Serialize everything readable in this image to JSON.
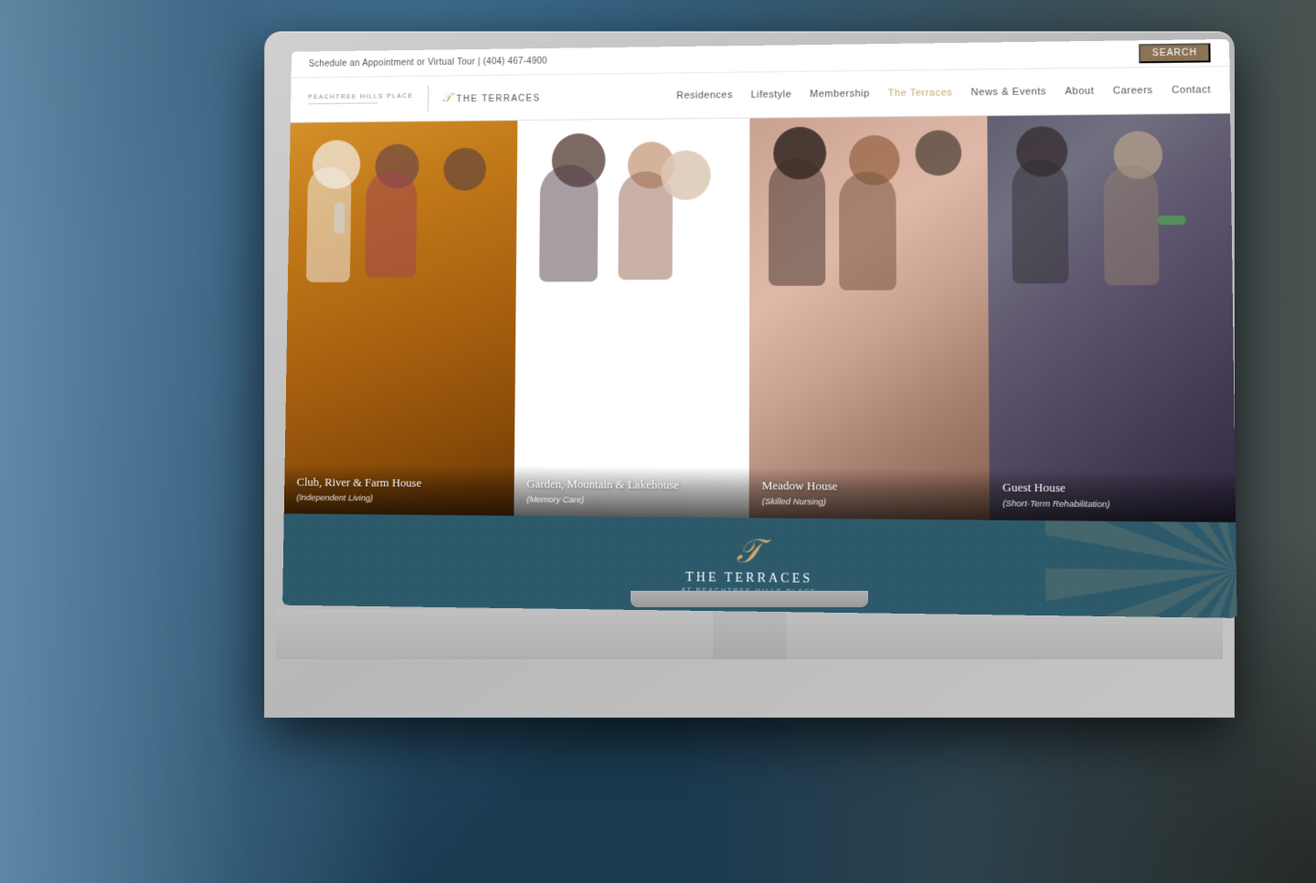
{
  "page": {
    "title": "The Terraces at Peachtree Hills Place"
  },
  "background": {
    "color": "#3d6b8a"
  },
  "topbar": {
    "contact_text": "Schedule an Appointment or Virtual Tour | (404) 467-4900",
    "search_label": "SEARCH"
  },
  "logo": {
    "peachtree_line1": "PEACHTREE HILLS PLACE",
    "terraces_name": "THE TERRACES"
  },
  "nav": {
    "links": [
      {
        "label": "Residences",
        "active": false
      },
      {
        "label": "Lifestyle",
        "active": false
      },
      {
        "label": "Membership",
        "active": false
      },
      {
        "label": "The Terraces",
        "active": true
      },
      {
        "label": "News & Events",
        "active": false
      },
      {
        "label": "About",
        "active": false
      },
      {
        "label": "Careers",
        "active": false
      },
      {
        "label": "Contact",
        "active": false
      }
    ]
  },
  "panels": [
    {
      "id": "panel1",
      "title": "Club, River & Farm House",
      "subtitle": "(Independent Living)"
    },
    {
      "id": "panel2",
      "title": "Garden, Mountain & Lakehouse",
      "subtitle": "(Memory Care)"
    },
    {
      "id": "panel3",
      "title": "Meadow House",
      "subtitle": "(Skilled Nursing)"
    },
    {
      "id": "panel4",
      "title": "Guest House",
      "subtitle": "(Short-Term Rehabilitation)"
    }
  ],
  "bottom_brand": {
    "icon": "𝒯",
    "name": "THE TERRACES",
    "subtitle": "AT PEACHTREE HILLS PLACE"
  },
  "icons": {
    "search": "🔍",
    "terraces_t": "𝒯"
  }
}
